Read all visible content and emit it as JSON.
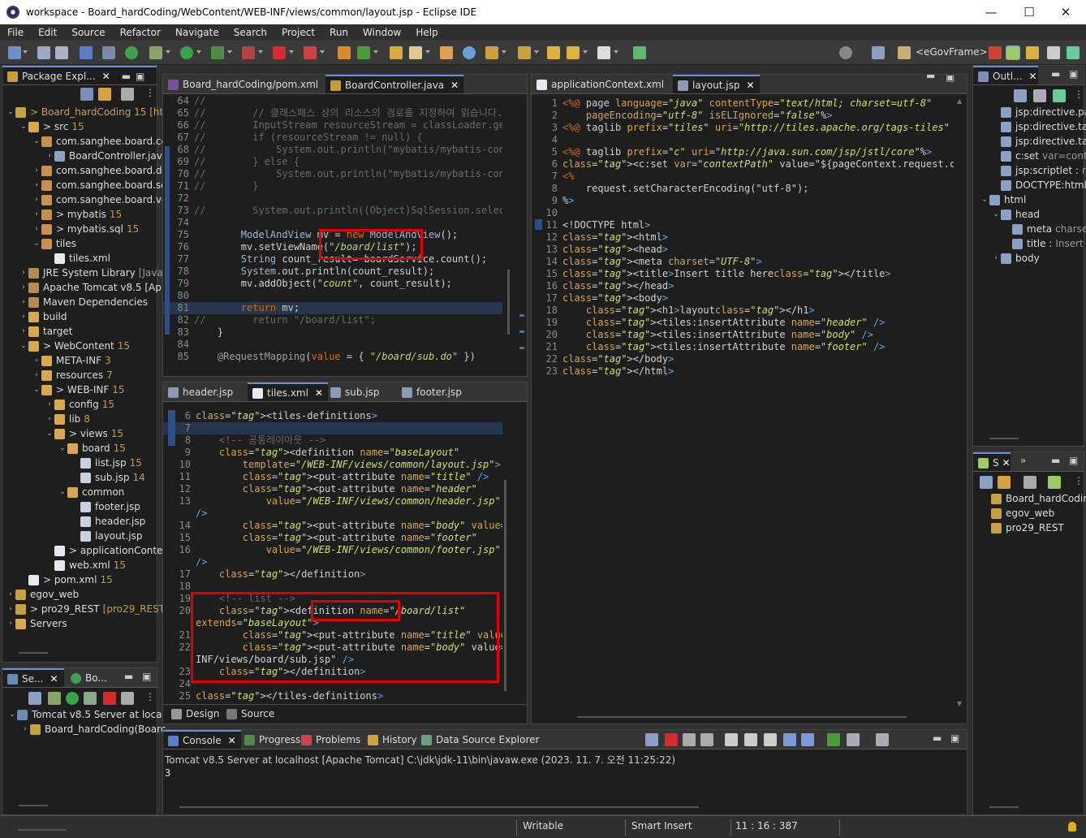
{
  "window": {
    "title": "workspace - Board_hardCoding/WebContent/WEB-INF/views/common/layout.jsp - Eclipse IDE",
    "minimize": "—",
    "maximize": "☐",
    "close": "✕"
  },
  "menu": [
    "File",
    "Edit",
    "Source",
    "Refactor",
    "Navigate",
    "Search",
    "Project",
    "Run",
    "Window",
    "Help"
  ],
  "toolbar": {
    "perspective_label": "<eGovFrame>"
  },
  "package_explorer": {
    "tab_label": "Package Expl...",
    "items": [
      {
        "indent": 0,
        "arrow": "⌄",
        "icon": "project-icon",
        "label": "> Board_hardCoding 15 [ht",
        "color": "#c8a060"
      },
      {
        "indent": 1,
        "arrow": "⌄",
        "icon": "folder-icon",
        "label": "> src",
        "deco": "15"
      },
      {
        "indent": 2,
        "arrow": "⌄",
        "icon": "package-icon",
        "label": "com.sanghee.board.co"
      },
      {
        "indent": 3,
        "arrow": "›",
        "icon": "java-icon",
        "label": "BoardController.jav"
      },
      {
        "indent": 2,
        "arrow": "›",
        "icon": "package-icon",
        "label": "com.sanghee.board.d"
      },
      {
        "indent": 2,
        "arrow": "›",
        "icon": "package-icon",
        "label": "com.sanghee.board.se"
      },
      {
        "indent": 2,
        "arrow": "›",
        "icon": "package-icon",
        "label": "com.sanghee.board.vo"
      },
      {
        "indent": 2,
        "arrow": "›",
        "icon": "package-icon",
        "label": "> mybatis",
        "deco": "15"
      },
      {
        "indent": 2,
        "arrow": "›",
        "icon": "package-icon",
        "label": "> mybatis.sql",
        "deco": "15"
      },
      {
        "indent": 2,
        "arrow": "⌄",
        "icon": "package-icon",
        "label": "tiles"
      },
      {
        "indent": 3,
        "arrow": "",
        "icon": "xml-icon",
        "label": "tiles.xml"
      },
      {
        "indent": 1,
        "arrow": "›",
        "icon": "library-icon",
        "label": "JRE System Library",
        "gray": "[Java"
      },
      {
        "indent": 1,
        "arrow": "›",
        "icon": "library-icon",
        "label": "Apache Tomcat v8.5 [Ap"
      },
      {
        "indent": 1,
        "arrow": "›",
        "icon": "library-icon",
        "label": "Maven Dependencies"
      },
      {
        "indent": 1,
        "arrow": "›",
        "icon": "folder-icon",
        "label": "build"
      },
      {
        "indent": 1,
        "arrow": "›",
        "icon": "folder-icon",
        "label": "target"
      },
      {
        "indent": 1,
        "arrow": "⌄",
        "icon": "folder-icon",
        "label": "> WebContent",
        "deco": "15"
      },
      {
        "indent": 2,
        "arrow": "›",
        "icon": "folder-icon",
        "label": "META-INF",
        "deco": "3"
      },
      {
        "indent": 2,
        "arrow": "›",
        "icon": "folder-icon",
        "label": "resources",
        "deco": "7"
      },
      {
        "indent": 2,
        "arrow": "⌄",
        "icon": "folder-icon",
        "label": "> WEB-INF",
        "deco": "15"
      },
      {
        "indent": 3,
        "arrow": "›",
        "icon": "folder-icon",
        "label": "config",
        "deco": "15"
      },
      {
        "indent": 3,
        "arrow": "›",
        "icon": "folder-icon",
        "label": "lib",
        "deco": "8"
      },
      {
        "indent": 3,
        "arrow": "⌄",
        "icon": "folder-icon",
        "label": "> views",
        "deco": "15"
      },
      {
        "indent": 4,
        "arrow": "⌄",
        "icon": "folder-icon",
        "label": "board",
        "deco": "15"
      },
      {
        "indent": 5,
        "arrow": "",
        "icon": "jsp-icon",
        "label": "list.jsp",
        "deco": "15"
      },
      {
        "indent": 5,
        "arrow": "",
        "icon": "jsp-icon",
        "label": "sub.jsp",
        "deco": "14"
      },
      {
        "indent": 4,
        "arrow": "⌄",
        "icon": "folder-icon",
        "label": "common"
      },
      {
        "indent": 5,
        "arrow": "",
        "icon": "jsp-icon",
        "label": "footer.jsp"
      },
      {
        "indent": 5,
        "arrow": "",
        "icon": "jsp-icon",
        "label": "header.jsp"
      },
      {
        "indent": 5,
        "arrow": "",
        "icon": "jsp-icon",
        "label": "layout.jsp"
      },
      {
        "indent": 3,
        "arrow": "",
        "icon": "xml-icon",
        "label": "> applicationConte"
      },
      {
        "indent": 3,
        "arrow": "",
        "icon": "xml-icon",
        "label": "web.xml",
        "deco": "15"
      },
      {
        "indent": 1,
        "arrow": "",
        "icon": "xml-icon",
        "label": "> pom.xml",
        "deco": "15"
      },
      {
        "indent": 0,
        "arrow": "›",
        "icon": "project-icon",
        "label": "egov_web"
      },
      {
        "indent": 0,
        "arrow": "›",
        "icon": "project-icon",
        "label": "> pro29_REST",
        "deco": "[pro29_REST"
      },
      {
        "indent": 0,
        "arrow": "›",
        "icon": "folder-icon",
        "label": "Servers"
      }
    ]
  },
  "servers_panel": {
    "tab1": "Se...",
    "tab2": "Bo...",
    "items": [
      "Tomcat v8.5 Server at local",
      "Board_hardCoding(Boarc"
    ]
  },
  "top_editor": {
    "tabs": [
      "Board_hardCoding/pom.xml",
      "BoardController.java"
    ],
    "lines": [
      {
        "n": "64",
        "t": "//"
      },
      {
        "n": "65",
        "t": "//        // 클래스패스 상의 리소스의 경로를 지정하여 읽습니다."
      },
      {
        "n": "66",
        "t": "//        InputStream resourceStream = classLoader.getRe"
      },
      {
        "n": "67",
        "t": "//        if (resourceStream != null) {"
      },
      {
        "n": "68",
        "t": "//            System.out.println(\"mybatis/mybatis-config"
      },
      {
        "n": "69",
        "t": "//        } else {"
      },
      {
        "n": "70",
        "t": "//            System.out.println(\"mybatis/mybatis-config"
      },
      {
        "n": "71",
        "t": "//        }"
      },
      {
        "n": "72",
        "t": ""
      },
      {
        "n": "73",
        "t": "//        System.out.println((Object)SqlSession.selectOr"
      },
      {
        "n": "74",
        "t": ""
      },
      {
        "n": "75",
        "t": "        ModelAndView mv = new ModelAndView();"
      },
      {
        "n": "76",
        "t": "        mv.setViewName(\"/board/list\");"
      },
      {
        "n": "77",
        "t": "        String count_result= boardService.count();"
      },
      {
        "n": "78",
        "t": "        System.out.println(count_result);"
      },
      {
        "n": "79",
        "t": "        mv.addObject(\"count\", count_result);"
      },
      {
        "n": "80",
        "t": ""
      },
      {
        "n": "81",
        "t": "        return mv;"
      },
      {
        "n": "82",
        "t": "//        return \"/board/list\";"
      },
      {
        "n": "83",
        "t": "    }"
      },
      {
        "n": "84",
        "t": ""
      },
      {
        "n": "85",
        "t": "    @RequestMapping(value = { \"/board/sub.do\" })"
      }
    ]
  },
  "tiles_editor": {
    "tabs": [
      "header.jsp",
      "tiles.xml",
      "sub.jsp",
      "footer.jsp"
    ],
    "bottom_tabs": [
      "Design",
      "Source"
    ],
    "lines": [
      {
        "n": "6",
        "t": "<tiles-definitions>"
      },
      {
        "n": "7",
        "t": ""
      },
      {
        "n": "8",
        "t": "    <!-- 공통레이아웃 -->"
      },
      {
        "n": "9",
        "t": "    <definition name=\"baseLayout\""
      },
      {
        "n": "10",
        "t": "        template=\"/WEB-INF/views/common/layout.jsp\">"
      },
      {
        "n": "11",
        "t": "        <put-attribute name=\"title\" />"
      },
      {
        "n": "12",
        "t": "        <put-attribute name=\"header\""
      },
      {
        "n": "13",
        "t": "            value=\"/WEB-INF/views/common/header.jsp\""
      },
      {
        "n": "",
        "t": "/>"
      },
      {
        "n": "14",
        "t": "        <put-attribute name=\"body\" value=\"\" />"
      },
      {
        "n": "15",
        "t": "        <put-attribute name=\"footer\""
      },
      {
        "n": "16",
        "t": "            value=\"/WEB-INF/views/common/footer.jsp\""
      },
      {
        "n": "",
        "t": "/>"
      },
      {
        "n": "17",
        "t": "    </definition>"
      },
      {
        "n": "18",
        "t": ""
      },
      {
        "n": "19",
        "t": "    <!-- list -->"
      },
      {
        "n": "20",
        "t": "    <definition name=\"/board/list\""
      },
      {
        "n": "",
        "t": "extends=\"baseLayout\">"
      },
      {
        "n": "21",
        "t": "        <put-attribute name=\"title\" value=\"타이틀\" />"
      },
      {
        "n": "22",
        "t": "        <put-attribute name=\"body\" value=\"/WEB-"
      },
      {
        "n": "",
        "t": "INF/views/board/sub.jsp\" />"
      },
      {
        "n": "23",
        "t": "    </definition>"
      },
      {
        "n": "24",
        "t": ""
      },
      {
        "n": "25",
        "t": "</tiles-definitions>"
      }
    ]
  },
  "layout_editor": {
    "tabs": [
      "applicationContext.xml",
      "layout.jsp"
    ],
    "lines": [
      {
        "n": "1",
        "t": "<%@ page language=\"java\" contentType=\"text/html; charset=utf-8\""
      },
      {
        "n": "2",
        "t": "    pageEncoding=\"utf-8\" isELIgnored=\"false\"%>"
      },
      {
        "n": "3",
        "t": "<%@ taglib prefix=\"tiles\" uri=\"http://tiles.apache.org/tags-tiles\""
      },
      {
        "n": "4",
        "t": ""
      },
      {
        "n": "5",
        "t": "<%@ taglib prefix=\"c\" uri=\"http://java.sun.com/jsp/jstl/core\"%>"
      },
      {
        "n": "6",
        "t": "<c:set var=\"contextPath\" value=\"${pageContext.request.contextPath}"
      },
      {
        "n": "7",
        "t": "<%"
      },
      {
        "n": "8",
        "t": "    request.setCharacterEncoding(\"utf-8\");"
      },
      {
        "n": "9",
        "t": "%>"
      },
      {
        "n": "10",
        "t": ""
      },
      {
        "n": "11",
        "t": "<!DOCTYPE html>"
      },
      {
        "n": "12",
        "t": "<html>"
      },
      {
        "n": "13",
        "t": "<head>"
      },
      {
        "n": "14",
        "t": "<meta charset=\"UTF-8\">"
      },
      {
        "n": "15",
        "t": "<title>Insert title here</title>"
      },
      {
        "n": "16",
        "t": "</head>"
      },
      {
        "n": "17",
        "t": "<body>"
      },
      {
        "n": "18",
        "t": "    <h1>layout</h1>"
      },
      {
        "n": "19",
        "t": "    <tiles:insertAttribute name=\"header\" />"
      },
      {
        "n": "20",
        "t": "    <tiles:insertAttribute name=\"body\" />"
      },
      {
        "n": "21",
        "t": "    <tiles:insertAttribute name=\"footer\" />"
      },
      {
        "n": "22",
        "t": "</body>"
      },
      {
        "n": "23",
        "t": "</html>"
      }
    ]
  },
  "outline": {
    "tab": "Outl...",
    "items": [
      {
        "indent": 1,
        "label": "jsp:directive.page"
      },
      {
        "indent": 1,
        "label": "jsp:directive.taglib"
      },
      {
        "indent": 1,
        "label": "jsp:directive.taglib"
      },
      {
        "indent": 1,
        "label": "c:set",
        "gray": "var=context"
      },
      {
        "indent": 1,
        "label": "jsp:scriptlet :",
        "gray": "requ"
      },
      {
        "indent": 1,
        "label": "DOCTYPE:html"
      },
      {
        "indent": 0,
        "arrow": "⌄",
        "label": "html"
      },
      {
        "indent": 1,
        "arrow": "⌄",
        "label": "head"
      },
      {
        "indent": 2,
        "label": "meta",
        "gray": "charse"
      },
      {
        "indent": 2,
        "label": "title :",
        "gray": "Insert"
      },
      {
        "indent": 1,
        "arrow": "›",
        "label": "body"
      }
    ]
  },
  "second_right_panel": {
    "tab": "S",
    "items": [
      "Board_hardCoding",
      "egov_web",
      "pro29_REST"
    ]
  },
  "console": {
    "tabs": [
      "Console",
      "Progress",
      "Problems",
      "History",
      "Data Source Explorer"
    ],
    "header": "Tomcat v8.5 Server at localhost [Apache Tomcat] C:\\jdk\\jdk-11\\bin\\javaw.exe  (2023. 11. 7. 오전 11:25:22)",
    "output": "3"
  },
  "statusbar": {
    "writable": "Writable",
    "insert_mode": "Smart Insert",
    "position": "11 : 16 : 387"
  }
}
